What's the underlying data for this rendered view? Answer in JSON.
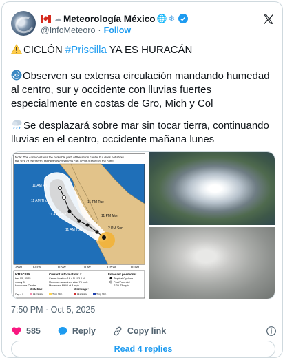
{
  "author": {
    "display_name": "Meteorología México",
    "handle": "@InfoMeteoro",
    "follow_label": "Follow",
    "verified": true
  },
  "tweet": {
    "line1_prefix": "CICLÓN ",
    "line1_hashtag": "#Priscilla",
    "line1_suffix": " YA ES HURACÁN",
    "paragraph2": "Observen su extensa circulación mandando humedad al centro, sur y occidente con lluvias fuertes especialmente en costas de Gro, Mich y Col",
    "paragraph3": "Se desplazará sobre mar sin tocar tierra, continuando lluvias en el centro, occidente mañana lunes"
  },
  "media": {
    "map": {
      "note": "Note: The cone contains the probable path of the storm center but does not show the size of the storm. Hazardous conditions can occur outside of the cone.",
      "track_labels": [
        "11 AM Fri",
        "11 AM Thu",
        "11 AM Wed",
        "11 AM Tue",
        "11 PM Tue",
        "11 PM Mon",
        "2 PM Sun"
      ],
      "lon_labels": [
        "125W",
        "120W",
        "115W",
        "110W",
        "105W",
        "100W"
      ],
      "storm_name": "Priscilla",
      "storm_date": "ber 05, 2025",
      "storm_lines": [
        "visory 5",
        "Hurricane Center"
      ],
      "current_info_title": "Current information: x",
      "current_info_lines": [
        "Center location 16.4 N 103.1 W",
        "Maximum sustained wind 75 mph",
        "Movement NNW at 3 mph"
      ],
      "forecast_title": "Forecast positions:",
      "forecast_lines": [
        "Tropical Cyclone",
        "Post/Potential",
        "S 39-73 mph"
      ],
      "watches_label": "Watches:",
      "warnings_label": "Warnings:",
      "legend_items": [
        "Hurricane",
        "Trop Stm",
        "Hurricane",
        "Trop Stm"
      ],
      "day_label": "Day 4-5"
    }
  },
  "meta": {
    "time": "7:50 PM",
    "separator": " · ",
    "date": "Oct 5, 2025"
  },
  "actions": {
    "like_count": "585",
    "reply_label": "Reply",
    "copy_link_label": "Copy link"
  },
  "read_replies_label": "Read 4 replies",
  "colors": {
    "accent": "#1d9bf0",
    "like": "#f91880",
    "text": "#0f1419",
    "muted": "#536471",
    "border": "#cfd9de"
  },
  "icons": [
    "canada-flag-icon",
    "snow-cloud-icon",
    "globe-icon",
    "snowflake-icon",
    "verified-badge-icon",
    "x-logo-icon",
    "warning-icon",
    "cyclone-icon",
    "cloud-rain-icon",
    "heart-icon",
    "reply-icon",
    "link-icon",
    "info-icon"
  ]
}
